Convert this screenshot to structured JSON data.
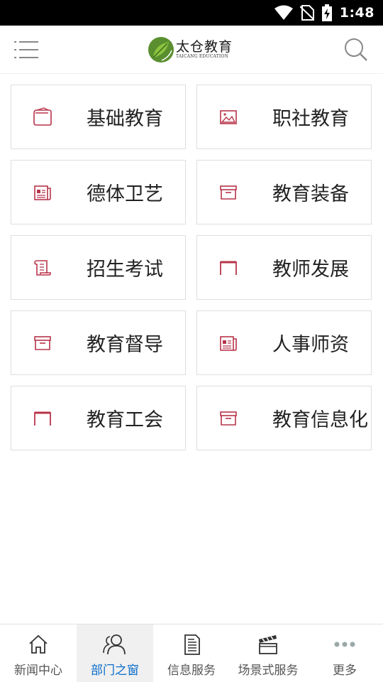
{
  "status_bar": {
    "time": "1:48",
    "icons": [
      "wifi-icon",
      "no-sim-icon",
      "battery-charging-icon"
    ]
  },
  "header": {
    "logo_title": "太仓教育",
    "logo_subtitle": "TAICANG EDUCATION",
    "menu_icon": "menu-icon",
    "search_icon": "search-icon"
  },
  "tiles": [
    {
      "label": "基础教育",
      "icon": "wallet-icon"
    },
    {
      "label": "职社教育",
      "icon": "image-icon"
    },
    {
      "label": "德体卫艺",
      "icon": "newspaper-icon"
    },
    {
      "label": "教育装备",
      "icon": "archive-box-icon"
    },
    {
      "label": "招生考试",
      "icon": "scroll-icon"
    },
    {
      "label": "教师发展",
      "icon": "frame-icon"
    },
    {
      "label": "教育督导",
      "icon": "archive-box-icon"
    },
    {
      "label": "人事师资",
      "icon": "newspaper-icon"
    },
    {
      "label": "教育工会",
      "icon": "frame-icon"
    },
    {
      "label": "教育信息化",
      "icon": "archive-box-icon"
    }
  ],
  "accent_color": "#b8344a",
  "active_nav_color": "#0a6cc9",
  "bottom_nav": [
    {
      "label": "新闻中心",
      "icon": "home-icon",
      "active": false
    },
    {
      "label": "部门之窗",
      "icon": "users-icon",
      "active": true
    },
    {
      "label": "信息服务",
      "icon": "document-icon",
      "active": false
    },
    {
      "label": "场景式服务",
      "icon": "clapperboard-icon",
      "active": false
    },
    {
      "label": "更多",
      "icon": "more-dots-icon",
      "active": false
    }
  ]
}
